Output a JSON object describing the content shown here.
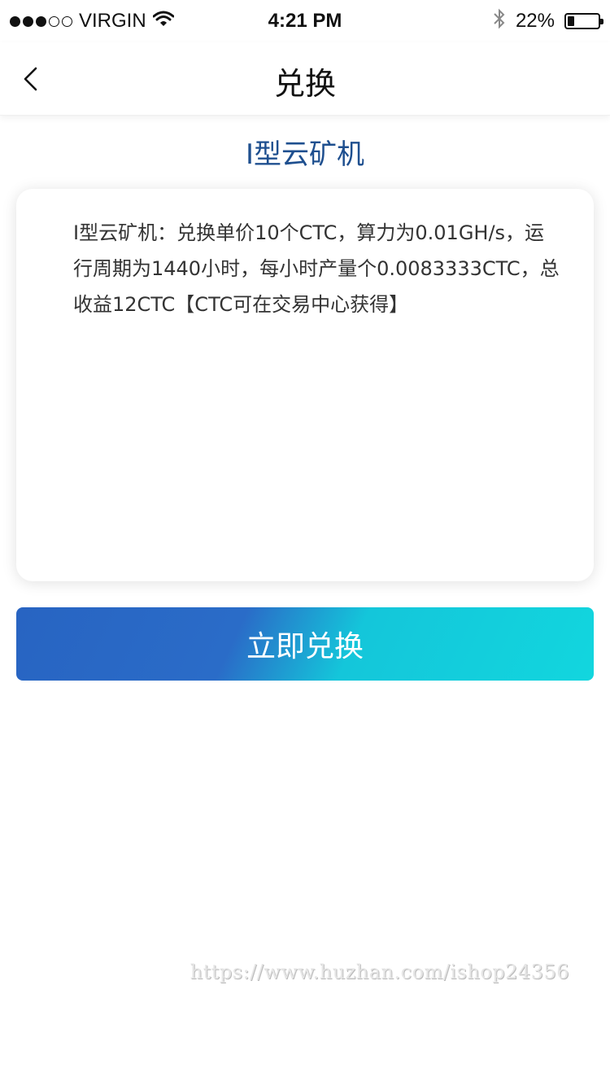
{
  "status_bar": {
    "carrier": "VIRGIN",
    "time": "4:21 PM",
    "battery": "22%",
    "battery_level": 0.22,
    "signal_bars_filled": 3,
    "signal_bars_total": 5,
    "icons": [
      "wifi-icon",
      "bluetooth-icon",
      "battery-icon"
    ]
  },
  "nav": {
    "title": "兑换",
    "back_icon": "chevron-left-icon"
  },
  "product": {
    "title": "Ⅰ型云矿机"
  },
  "description": {
    "text": "Ⅰ型云矿机：兑换单价10个CTC，算力为0.01GH/s，运行周期为1440小时，每小时产量个0.0083333CTC，总收益12CTC【CTC可在交易中心获得】"
  },
  "actions": {
    "exchange_label": "立即兑换"
  },
  "watermark": {
    "text": "https://www.huzhan.com/ishop24356"
  },
  "colors": {
    "title_blue": "#1e4f8f",
    "button_start": "#2864c2",
    "button_end": "#12d6de"
  }
}
